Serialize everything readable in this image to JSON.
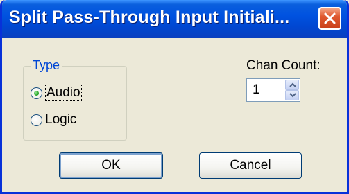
{
  "window": {
    "title": "Split Pass-Through Input Initiali..."
  },
  "type_group": {
    "title": "Type",
    "options": [
      {
        "label": "Audio",
        "checked": true
      },
      {
        "label": "Logic",
        "checked": false
      }
    ]
  },
  "chan_count": {
    "label": "Chan Count:",
    "value": "1"
  },
  "buttons": {
    "ok": "OK",
    "cancel": "Cancel"
  },
  "colors": {
    "titlebar": "#0052e0",
    "close_button": "#e0592f",
    "group_title": "#0046d5",
    "dialog_bg": "#ece9d8"
  }
}
